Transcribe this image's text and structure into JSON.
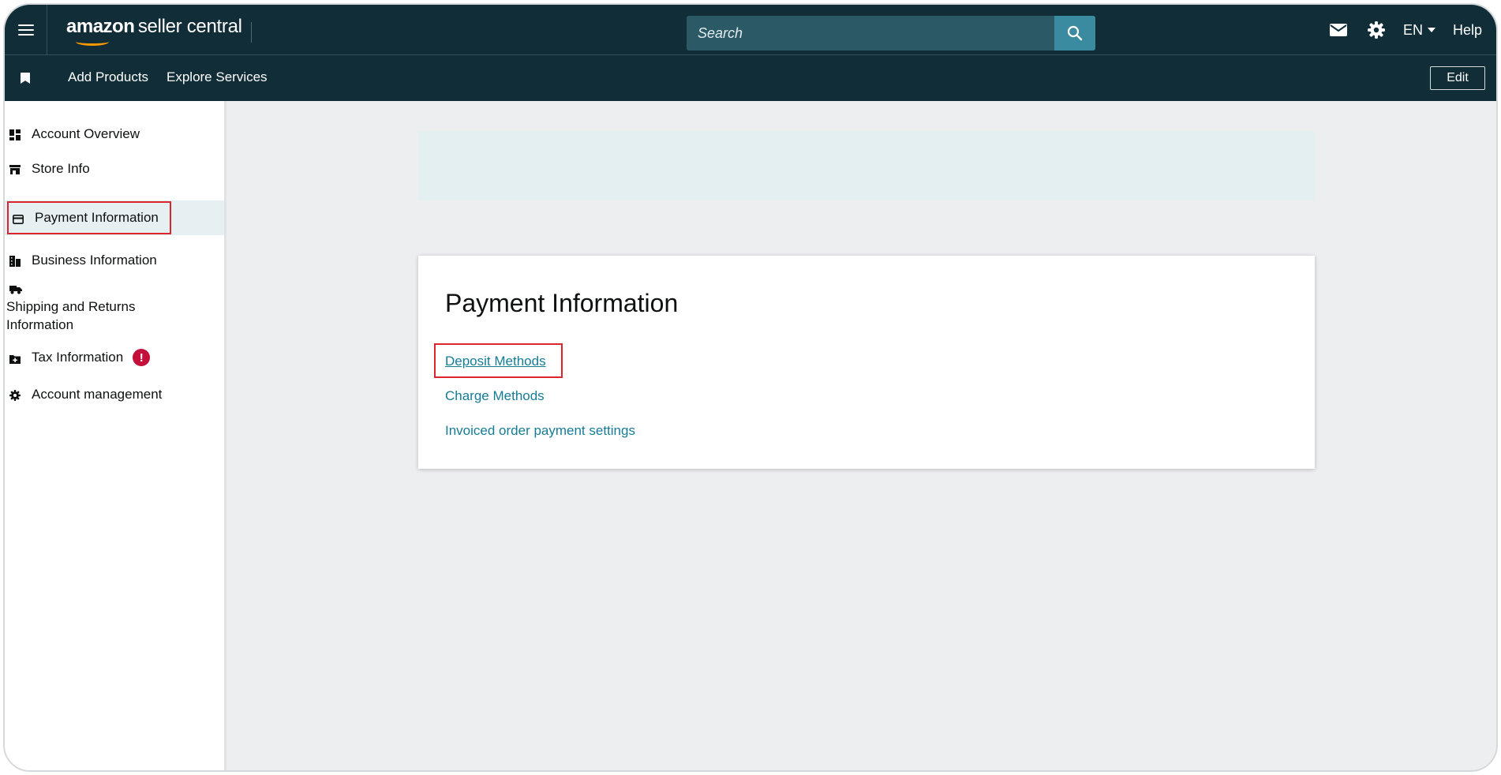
{
  "header": {
    "logo_primary": "amazon",
    "logo_secondary": "seller central",
    "search_placeholder": "Search",
    "language": "EN",
    "help": "Help"
  },
  "subnav": {
    "add_products": "Add Products",
    "explore_services": "Explore Services",
    "edit": "Edit"
  },
  "sidebar": {
    "items": [
      {
        "label": "Account Overview",
        "icon": "dashboard-icon"
      },
      {
        "label": "Store Info",
        "icon": "store-icon"
      },
      {
        "label": "Payment Information",
        "icon": "card-icon",
        "active": true
      },
      {
        "label": "Business Information",
        "icon": "building-icon"
      },
      {
        "label": "Shipping and Returns Information",
        "icon": "truck-icon"
      },
      {
        "label": "Tax Information",
        "icon": "folder-plus-icon",
        "badge": "!"
      },
      {
        "label": "Account management",
        "icon": "gear-icon"
      }
    ]
  },
  "main": {
    "card_title": "Payment Information",
    "links": [
      "Deposit Methods",
      "Charge Methods",
      "Invoiced order payment settings"
    ]
  },
  "colors": {
    "nav_bg": "#112e38",
    "search_bg": "#2b5a66",
    "search_button": "#3a8aa0",
    "link": "#167c94",
    "highlight_box": "#d9252e",
    "alert": "#c40f3a",
    "active_item_bg": "#e6f0f2"
  }
}
